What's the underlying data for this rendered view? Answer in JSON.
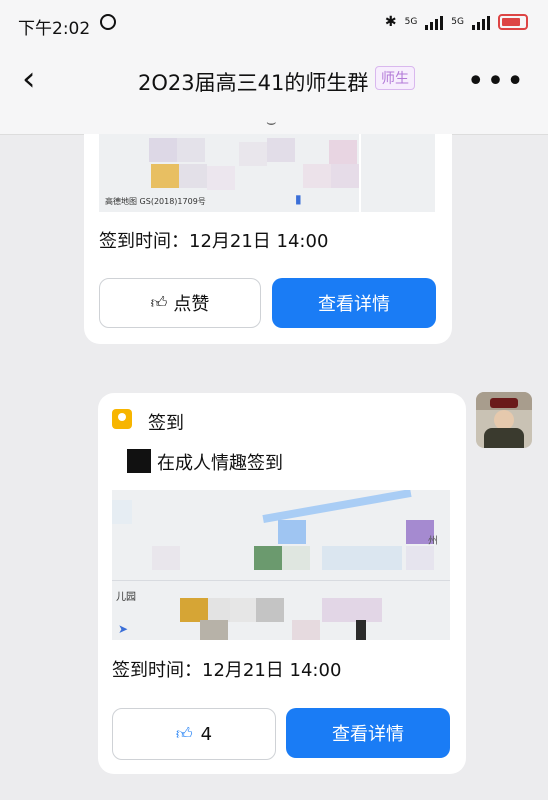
{
  "status_bar": {
    "time": "下午2:02",
    "network_a": "5G",
    "network_b": "5G",
    "battery": "100"
  },
  "header": {
    "title": "2O23届高三41的师生群",
    "tag": "师生"
  },
  "messages": [
    {
      "map_credit": "高德地图  GS(2018)1709号",
      "checkin_time": "签到时间：12月21日  14:00",
      "like_label": "点赞",
      "detail_label": "查看详情"
    },
    {
      "app_name": "签到",
      "checkin_text": "在成人情趣签到",
      "map_place_a": "儿园",
      "map_place_b": "州",
      "checkin_time": "签到时间：12月21日  14:00",
      "like_count": "4",
      "detail_label": "查看详情"
    }
  ],
  "colors": {
    "accent": "#1a7cf5",
    "tag": "#b37ad8",
    "app_icon": "#f7b500"
  },
  "icons": [
    "back-arrow-icon",
    "more-icon",
    "thumbs-up-icon",
    "alarm-icon",
    "bluetooth-icon",
    "battery-icon"
  ]
}
